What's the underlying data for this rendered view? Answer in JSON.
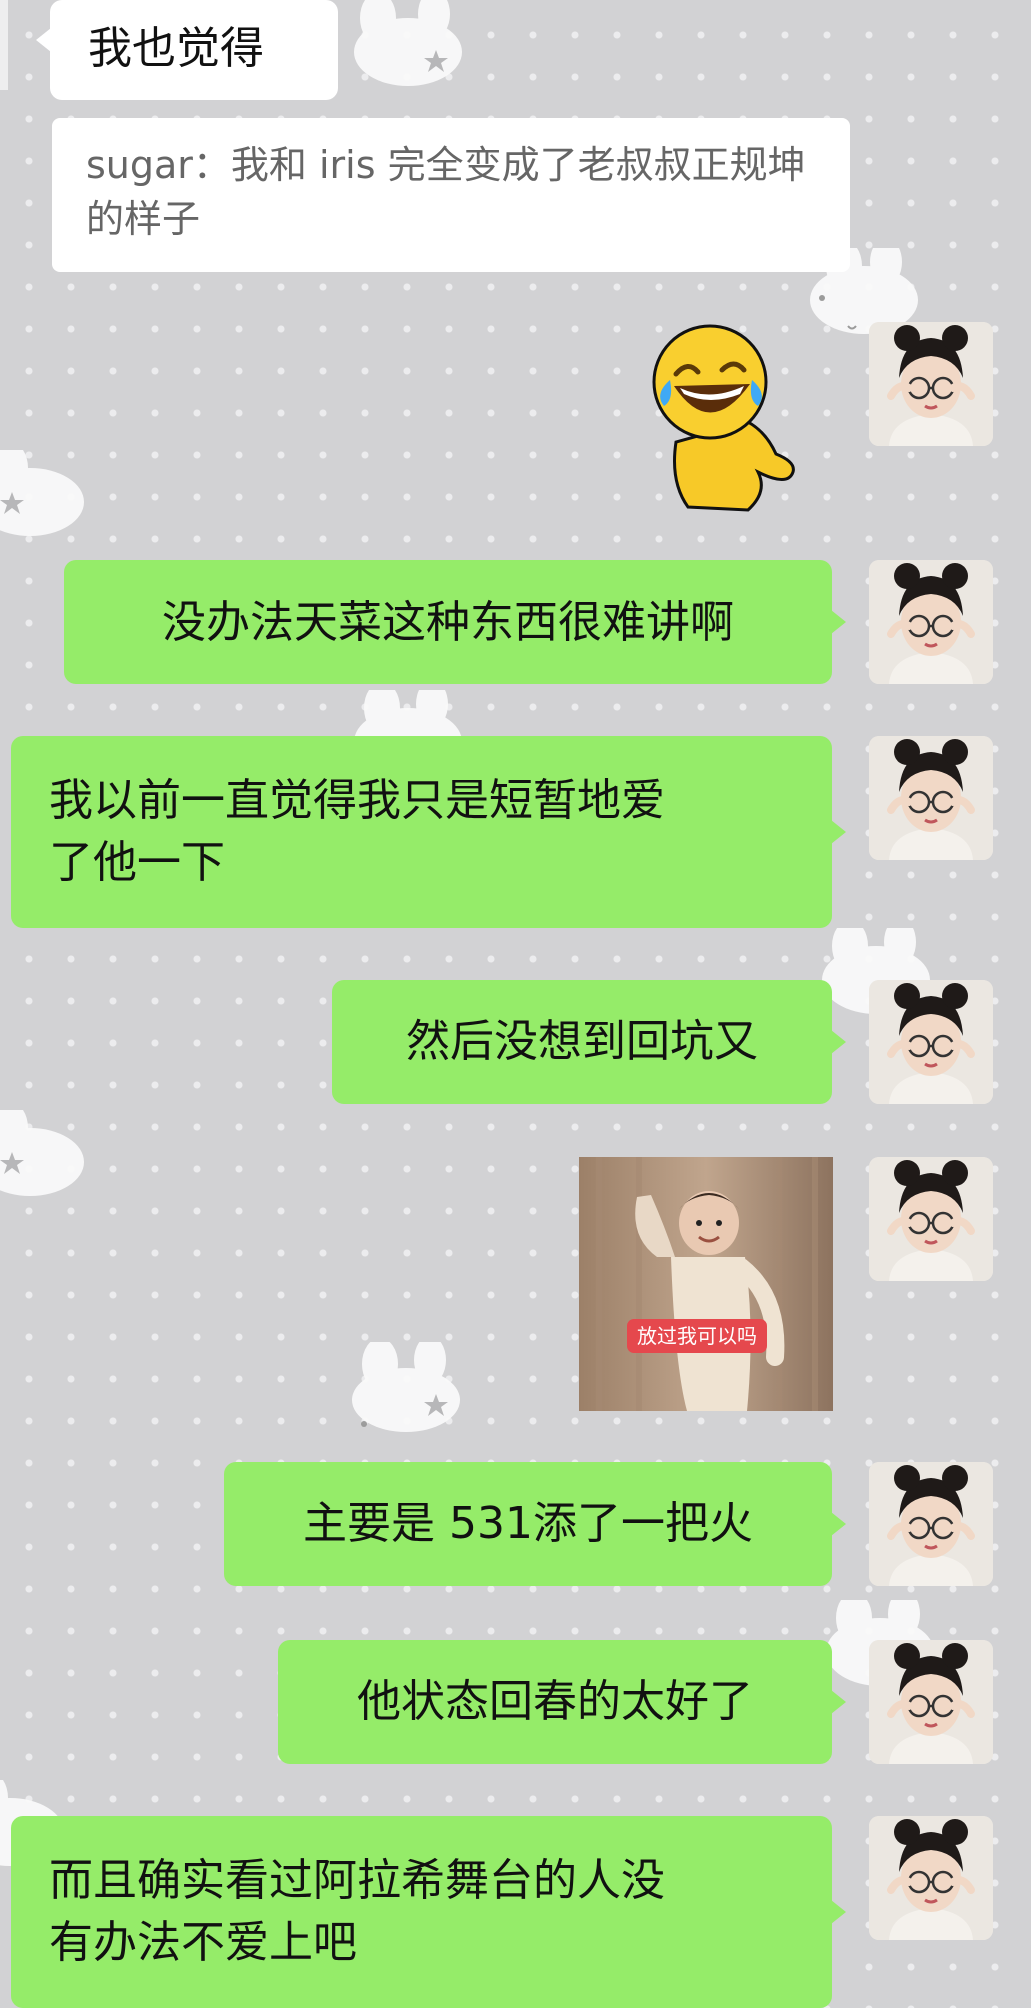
{
  "chat": {
    "messages": [
      {
        "id": "incoming-1",
        "side": "left",
        "text": "我也觉得"
      },
      {
        "id": "quoted-message",
        "side": "left",
        "text": "sugar：我和 iris 完全变成了老叔叔正规坤的样子"
      },
      {
        "id": "sticker-laughing",
        "side": "right",
        "type": "sticker",
        "icon": "laughing-crying-emoji-sticker"
      },
      {
        "id": "outgoing-1",
        "side": "right",
        "text": "没办法天菜这种东西很难讲啊"
      },
      {
        "id": "outgoing-2",
        "side": "right",
        "lines": [
          "我以前一直觉得我只是短暂地爱",
          "了他一下"
        ]
      },
      {
        "id": "outgoing-3",
        "side": "right",
        "text": "然后没想到回坑又"
      },
      {
        "id": "sticker-baby",
        "side": "right",
        "type": "image-sticker",
        "caption": "放过我可以吗"
      },
      {
        "id": "outgoing-4",
        "side": "right",
        "text": "主要是 531添了一把火"
      },
      {
        "id": "outgoing-5",
        "side": "right",
        "text": "他状态回春的太好了"
      },
      {
        "id": "outgoing-6",
        "side": "right",
        "lines": [
          "而且确实看过阿拉希舞台的人没",
          "有办法不爱上吧"
        ]
      }
    ]
  },
  "theme": {
    "background": "#d2d2d4",
    "outgoing_bubble": "#95ec69",
    "incoming_bubble": "#ffffff",
    "avatar_icon": "user-avatar-photo"
  }
}
